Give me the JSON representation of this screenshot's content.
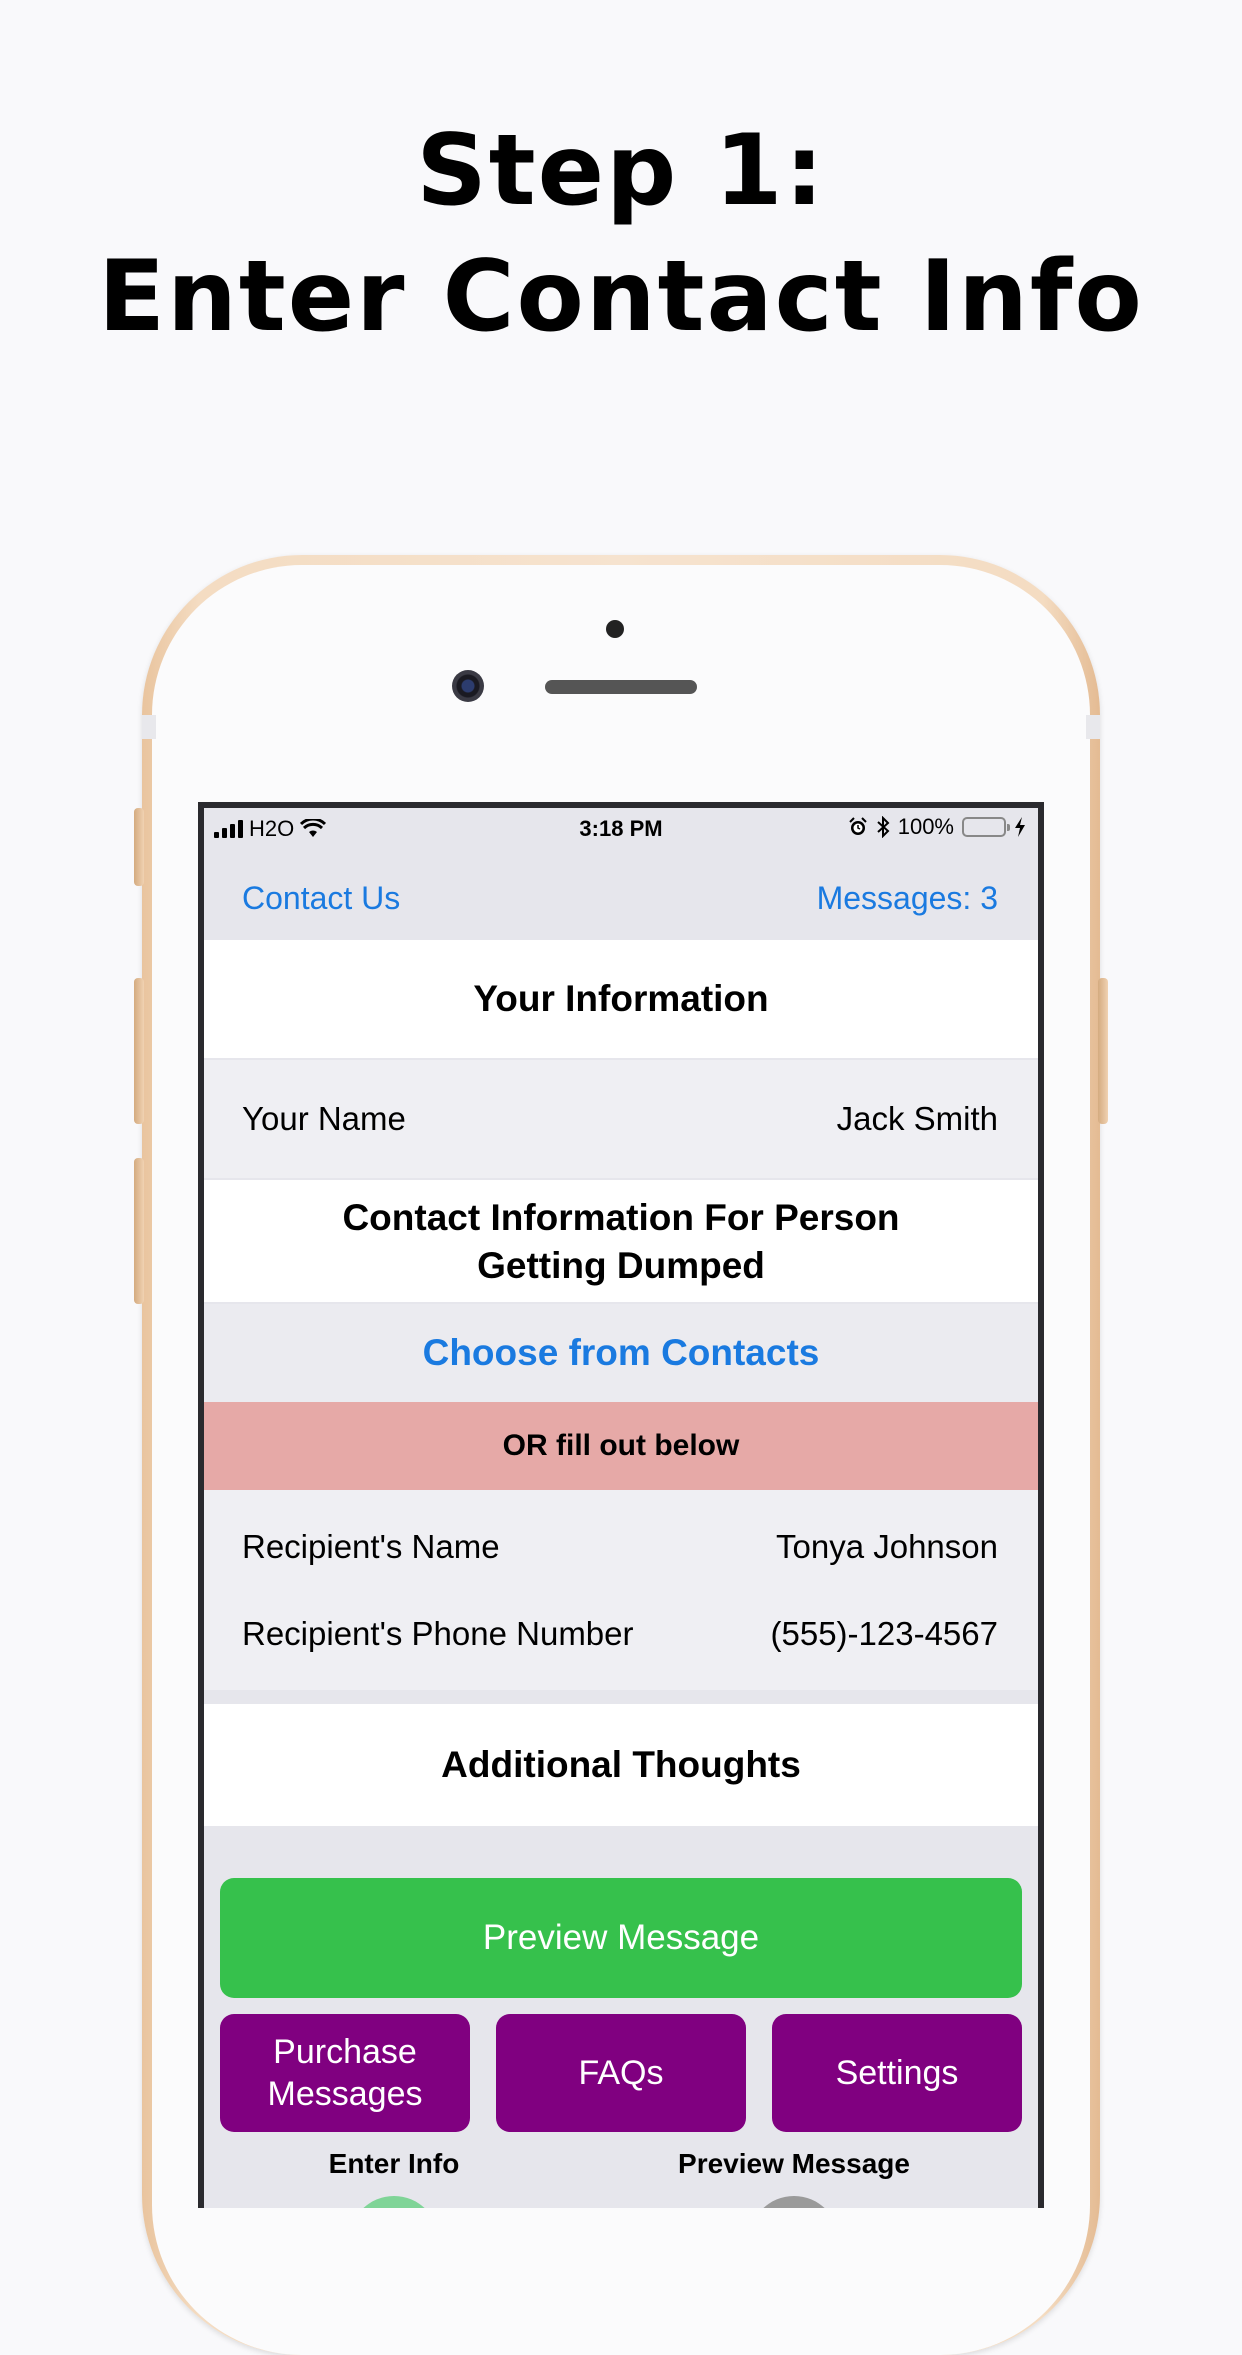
{
  "headline": {
    "line1": "Step 1:",
    "line2": "Enter Contact Info"
  },
  "status_bar": {
    "carrier": "H2O",
    "time": "3:18 PM",
    "battery_text": "100%",
    "icons": [
      "signal-bars-icon",
      "wifi-icon",
      "alarm-icon",
      "bluetooth-icon",
      "battery-icon",
      "charging-bolt-icon"
    ]
  },
  "navbar": {
    "left_label": "Contact Us",
    "right_label": "Messages: 3"
  },
  "your_information": {
    "header": "Your Information",
    "name_label": "Your Name",
    "name_value": "Jack Smith"
  },
  "recipient": {
    "header_line1": "Contact Information For Person",
    "header_line2": "Getting Dumped",
    "choose_contacts": "Choose from Contacts",
    "or_text": "OR fill out below",
    "name_label": "Recipient's Name",
    "name_value": "Tonya Johnson",
    "phone_label": "Recipient's Phone Number",
    "phone_value": "(555)-123-4567"
  },
  "additional": {
    "header": "Additional Thoughts"
  },
  "buttons": {
    "preview": "Preview Message",
    "purchase_line1": "Purchase",
    "purchase_line2": "Messages",
    "faqs": "FAQs",
    "settings": "Settings"
  },
  "steps": {
    "enter_info": "Enter Info",
    "preview_message": "Preview Message"
  },
  "colors": {
    "link_blue": "#1a7ae0",
    "preview_green": "#36c14c",
    "purple": "#800080",
    "or_band": "#e6a9a7",
    "step_active": "#7fd497",
    "step_inactive": "#9a9a9a"
  }
}
